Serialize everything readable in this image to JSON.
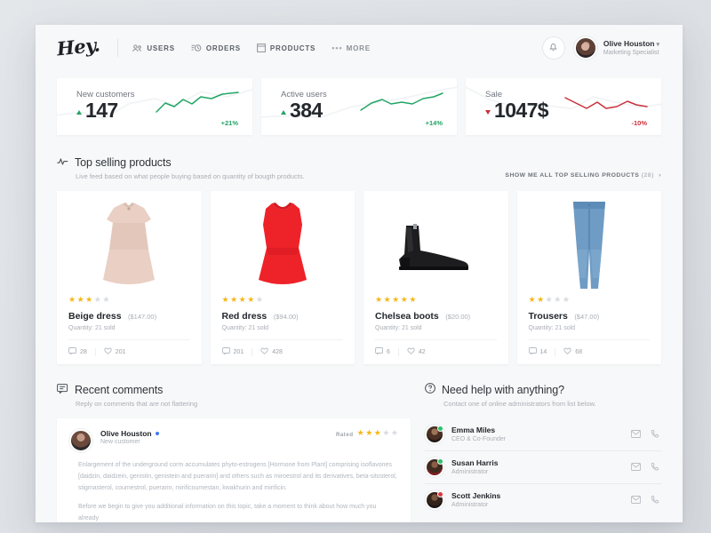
{
  "brand": {
    "logo": "Hey."
  },
  "nav": {
    "items": [
      {
        "label": "Users",
        "icon": "users-icon"
      },
      {
        "label": "Orders",
        "icon": "orders-icon"
      },
      {
        "label": "Products",
        "icon": "products-icon"
      }
    ],
    "more": "More"
  },
  "account": {
    "name": "Olive Houston",
    "role": "Marketing Specialist",
    "caret": "▾",
    "bell_icon": "bell-icon"
  },
  "stats": [
    {
      "label": "New customers",
      "value": "147",
      "change": "+21%",
      "direction": "up",
      "color": "#22a565"
    },
    {
      "label": "Active users",
      "value": "384",
      "change": "+14%",
      "direction": "up",
      "color": "#22a565"
    },
    {
      "label": "Sale",
      "value": "1047$",
      "change": "-10%",
      "direction": "down",
      "color": "#c8303c"
    }
  ],
  "top_selling": {
    "title": "Top selling products",
    "subtitle": "Live feed based on what people buying based on quantity of bougth products.",
    "link": "Show me all top selling products",
    "link_count": "(28)",
    "link_chevron": "›",
    "products": [
      {
        "name": "Beige dress",
        "price": "($147.00)",
        "quantity": "Quantity: 21 sold",
        "rating": 3,
        "comments": "28",
        "likes": "201"
      },
      {
        "name": "Red dress",
        "price": "($94.00)",
        "quantity": "Quantity: 21 sold",
        "rating": 4,
        "comments": "201",
        "likes": "428"
      },
      {
        "name": "Chelsea boots",
        "price": "($20.00)",
        "quantity": "Quantity: 21 sold",
        "rating": 5,
        "comments": "6",
        "likes": "42"
      },
      {
        "name": "Trousers",
        "price": "($47.00)",
        "quantity": "Quantity: 21 sold",
        "rating": 2,
        "comments": "14",
        "likes": "68"
      }
    ]
  },
  "recent_comments": {
    "title": "Recent comments",
    "subtitle": "Reply on comments that are not flattering",
    "comment": {
      "author": "Olive Houston",
      "role": "New customer",
      "rated_label": "Rated",
      "rating": 3,
      "paragraph1": "Enlargement of the underground corm accumulates phyto-estrogens [Hormone from Plant] comprising isoflavones [daidzin, daidzein, genistin, genistein and puerarin] and others such as miroestrol and its derivatives, beta-sitosterol, stigmasterol, coumestrol, puerarin, mirificoumestan, kwakhurin and mirificin.",
      "paragraph2": "Before we begin to give you additional information on this topic, take a moment to think about how much you already"
    }
  },
  "help": {
    "title": "Need help with anything?",
    "subtitle": "Contact one of online administrators from list below.",
    "admins": [
      {
        "name": "Emma Miles",
        "role": "CEO & Co-Founder",
        "status": "online",
        "status_color": "#2fc16b"
      },
      {
        "name": "Susan Harris",
        "role": "Administrator",
        "status": "online",
        "status_color": "#2fc16b"
      },
      {
        "name": "Scott Jenkins",
        "role": "Administrator",
        "status": "offline",
        "status_color": "#e0363f"
      }
    ],
    "mail_icon": "mail-icon",
    "phone_icon": "phone-icon"
  }
}
